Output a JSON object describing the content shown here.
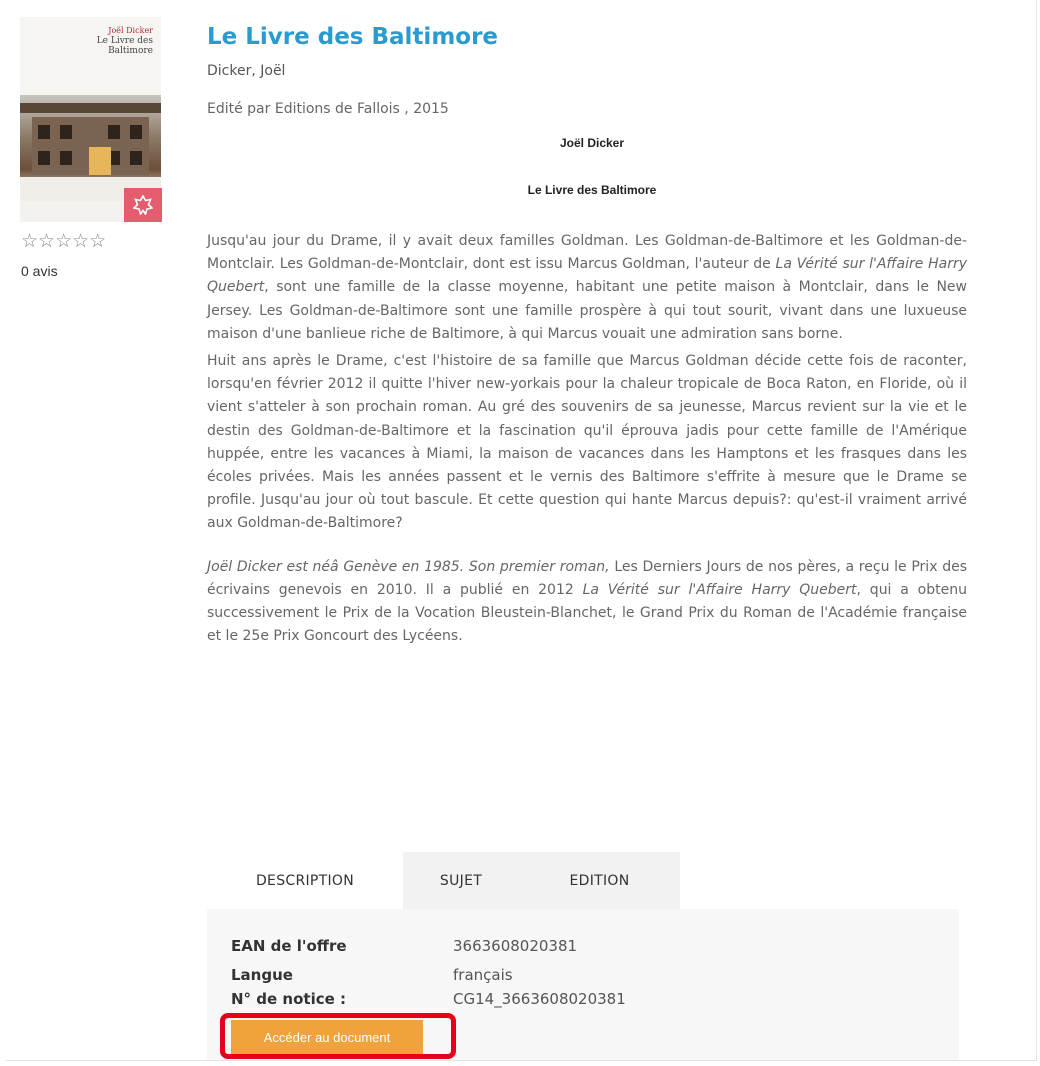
{
  "book": {
    "title": "Le Livre des Baltimore",
    "author": "Dicker, Joël",
    "publisher": "Edité par Editions de Fallois , 2015",
    "credit_author": "Joël Dicker",
    "credit_title": "Le Livre des Baltimore",
    "cover": {
      "author": "Joël Dicker",
      "title": "Le Livre des Baltimore"
    },
    "rating_stars": "☆☆☆☆☆",
    "rating_value": 0,
    "reviews": "0 avis"
  },
  "description": {
    "p1a": "Jusqu'au jour du Drame, il y avait deux familles Goldman. Les Goldman-de-Baltimore et les Goldman-de-Montclair. Les Goldman-de-Montclair, dont est issu Marcus Goldman, l'auteur de ",
    "p1i": "La Vérité sur l'Affaire Harry Quebert",
    "p1b": ", sont une famille de la classe moyenne, habitant une petite maison à Montclair, dans le New Jersey. Les Goldman-de-Baltimore sont une famille prospère à qui tout sourit, vivant dans une luxueuse maison d'une banlieue riche de Baltimore, à qui Marcus vouait une admiration sans borne.",
    "p2": "Huit ans après le Drame, c'est l'histoire de sa famille que Marcus Goldman décide cette fois de raconter, lorsqu'en février 2012 il quitte l'hiver new-yorkais pour la chaleur tropicale de Boca Raton, en Floride, où il vient s'atteler à son prochain roman. Au gré des souvenirs de sa jeunesse, Marcus revient sur la vie et le destin des Goldman-de-Baltimore et la fascination qu'il éprouva jadis pour cette famille de l'Amérique huppée, entre les vacances à Miami, la maison de vacances dans les Hamptons et les frasques dans les écoles privées. Mais les années passent et le vernis des Baltimore s'effrite à mesure que le Drame se profile. Jusqu'au jour où tout bascule. Et cette question qui hante Marcus depuis?: qu'est-il vraiment arrivé aux Goldman-de-Baltimore?",
    "p3i": "Joël Dicker est néâ Genève en 1985. Son premier roman,",
    "p3a": " Les Derniers Jours de nos pères, a reçu le Prix des écrivains genevois en 2010. Il a publié en 2012 ",
    "p3i2": "La Vérité sur l'Affaire Harry Quebert",
    "p3b": ", qui a obtenu successivement le Prix de la Vocation Bleustein-Blanchet, le Grand Prix du Roman de l'Académie française et le 25e Prix Goncourt des Lycéens."
  },
  "tabs": [
    {
      "label": "DESCRIPTION",
      "active": true
    },
    {
      "label": "SUJET",
      "active": false
    },
    {
      "label": "EDITION",
      "active": false
    }
  ],
  "details": [
    {
      "label": "EAN de l'offre",
      "value": "3663608020381"
    },
    {
      "label": "Langue",
      "value": "français"
    },
    {
      "label": "N° de notice :",
      "value": "CG14_3663608020381"
    }
  ],
  "access_button": "Accéder au document",
  "colors": {
    "title": "#2a9bd0",
    "button": "#f0a23c",
    "highlight": "#e5001c",
    "badge": "#e45c6e"
  }
}
